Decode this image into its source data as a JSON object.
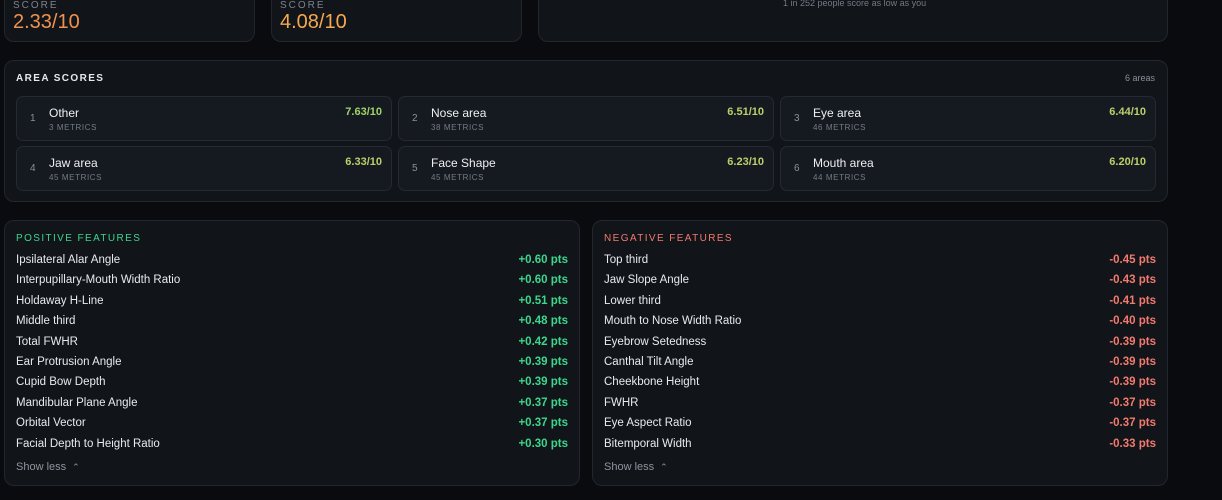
{
  "scores": [
    {
      "label": "SCORE",
      "value": "2.33/10",
      "color": "#f0924e"
    },
    {
      "label": "SCORE",
      "value": "4.08/10",
      "color": "#f5a850"
    }
  ],
  "percentile_text": "1 in 252 people score as low as you",
  "area_scores": {
    "title": "AREA SCORES",
    "count": "6 areas",
    "items": [
      {
        "index": "1",
        "name": "Other",
        "metrics": "3 METRICS",
        "score": "7.63/10"
      },
      {
        "index": "2",
        "name": "Nose area",
        "metrics": "38 METRICS",
        "score": "6.51/10"
      },
      {
        "index": "3",
        "name": "Eye area",
        "metrics": "46 METRICS",
        "score": "6.44/10"
      },
      {
        "index": "4",
        "name": "Jaw area",
        "metrics": "45 METRICS",
        "score": "6.33/10"
      },
      {
        "index": "5",
        "name": "Face Shape",
        "metrics": "45 METRICS",
        "score": "6.23/10"
      },
      {
        "index": "6",
        "name": "Mouth area",
        "metrics": "44 METRICS",
        "score": "6.20/10"
      }
    ]
  },
  "positive": {
    "title": "POSITIVE FEATURES",
    "color": "#3dd68c",
    "items": [
      {
        "name": "Ipsilateral Alar Angle",
        "value": "+0.60 pts"
      },
      {
        "name": "Interpupillary-Mouth Width Ratio",
        "value": "+0.60 pts"
      },
      {
        "name": "Holdaway H-Line",
        "value": "+0.51 pts"
      },
      {
        "name": "Middle third",
        "value": "+0.48 pts"
      },
      {
        "name": "Total FWHR",
        "value": "+0.42 pts"
      },
      {
        "name": "Ear Protrusion Angle",
        "value": "+0.39 pts"
      },
      {
        "name": "Cupid Bow Depth",
        "value": "+0.39 pts"
      },
      {
        "name": "Mandibular Plane Angle",
        "value": "+0.37 pts"
      },
      {
        "name": "Orbital Vector",
        "value": "+0.37 pts"
      },
      {
        "name": "Facial Depth to Height Ratio",
        "value": "+0.30 pts"
      }
    ],
    "show_less": "Show less"
  },
  "negative": {
    "title": "NEGATIVE FEATURES",
    "color": "#f27a6e",
    "items": [
      {
        "name": "Top third",
        "value": "-0.45 pts"
      },
      {
        "name": "Jaw Slope Angle",
        "value": "-0.43 pts"
      },
      {
        "name": "Lower third",
        "value": "-0.41 pts"
      },
      {
        "name": "Mouth to Nose Width Ratio",
        "value": "-0.40 pts"
      },
      {
        "name": "Eyebrow Setedness",
        "value": "-0.39 pts"
      },
      {
        "name": "Canthal Tilt Angle",
        "value": "-0.39 pts"
      },
      {
        "name": "Cheekbone Height",
        "value": "-0.39 pts"
      },
      {
        "name": "FWHR",
        "value": "-0.37 pts"
      },
      {
        "name": "Eye Aspect Ratio",
        "value": "-0.37 pts"
      },
      {
        "name": "Bitemporal Width",
        "value": "-0.33 pts"
      }
    ],
    "show_less": "Show less"
  },
  "icons": {
    "show_less_chevron": "chevron-up-icon"
  }
}
